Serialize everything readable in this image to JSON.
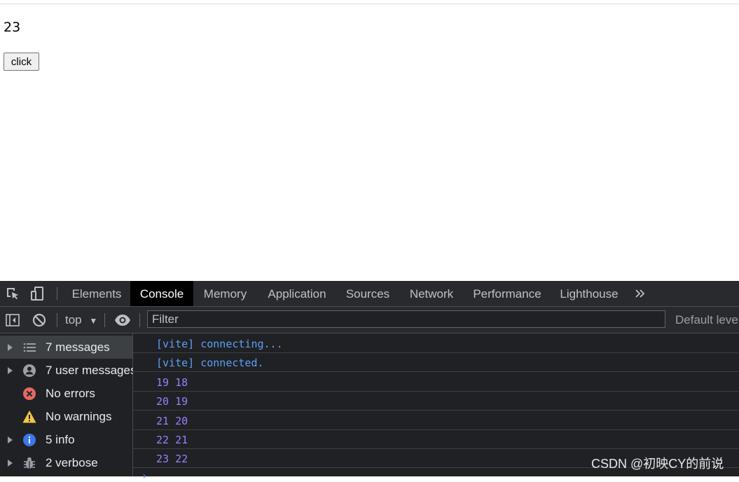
{
  "page": {
    "counter_value": "23",
    "button_label": "click"
  },
  "devtools": {
    "tabs": [
      {
        "label": "Elements",
        "active": false
      },
      {
        "label": "Console",
        "active": true
      },
      {
        "label": "Memory",
        "active": false
      },
      {
        "label": "Application",
        "active": false
      },
      {
        "label": "Sources",
        "active": false
      },
      {
        "label": "Network",
        "active": false
      },
      {
        "label": "Performance",
        "active": false
      },
      {
        "label": "Lighthouse",
        "active": false
      }
    ],
    "more_tabs_icon": "chevrons-right-icon",
    "toolbar": {
      "context": "top",
      "filter_placeholder": "Filter",
      "levels_label": "Default levels"
    },
    "sidebar": [
      {
        "label": "7 messages",
        "icon": "list-icon",
        "expandable": true,
        "selected": true
      },
      {
        "label": "7 user messages",
        "icon": "user-icon",
        "expandable": true,
        "selected": false
      },
      {
        "label": "No errors",
        "icon": "error-icon",
        "expandable": false,
        "selected": false
      },
      {
        "label": "No warnings",
        "icon": "warning-icon",
        "expandable": false,
        "selected": false
      },
      {
        "label": "5 info",
        "icon": "info-icon",
        "expandable": true,
        "selected": false
      },
      {
        "label": "2 verbose",
        "icon": "bug-icon",
        "expandable": true,
        "selected": false
      }
    ],
    "messages": [
      {
        "text": "[vite] connecting...",
        "color": "#5aa2f5"
      },
      {
        "text": "[vite] connected.",
        "color": "#5aa2f5"
      },
      {
        "text": "19 18",
        "color": "#9980ff"
      },
      {
        "text": "20 19",
        "color": "#9980ff"
      },
      {
        "text": "21 20",
        "color": "#9980ff"
      },
      {
        "text": "22 21",
        "color": "#9980ff"
      },
      {
        "text": "23 22",
        "color": "#9980ff"
      }
    ]
  },
  "watermark": "CSDN @初映CY的前说",
  "colors": {
    "devtools_bg": "#202124",
    "toolbar_bg": "#292a2d",
    "active_tab_bg": "#000000",
    "vite_blue": "#5aa2f5",
    "log_purple": "#9980ff",
    "error_red": "#e46962",
    "warning_yellow": "#f2c744",
    "info_blue": "#3b78e7"
  }
}
